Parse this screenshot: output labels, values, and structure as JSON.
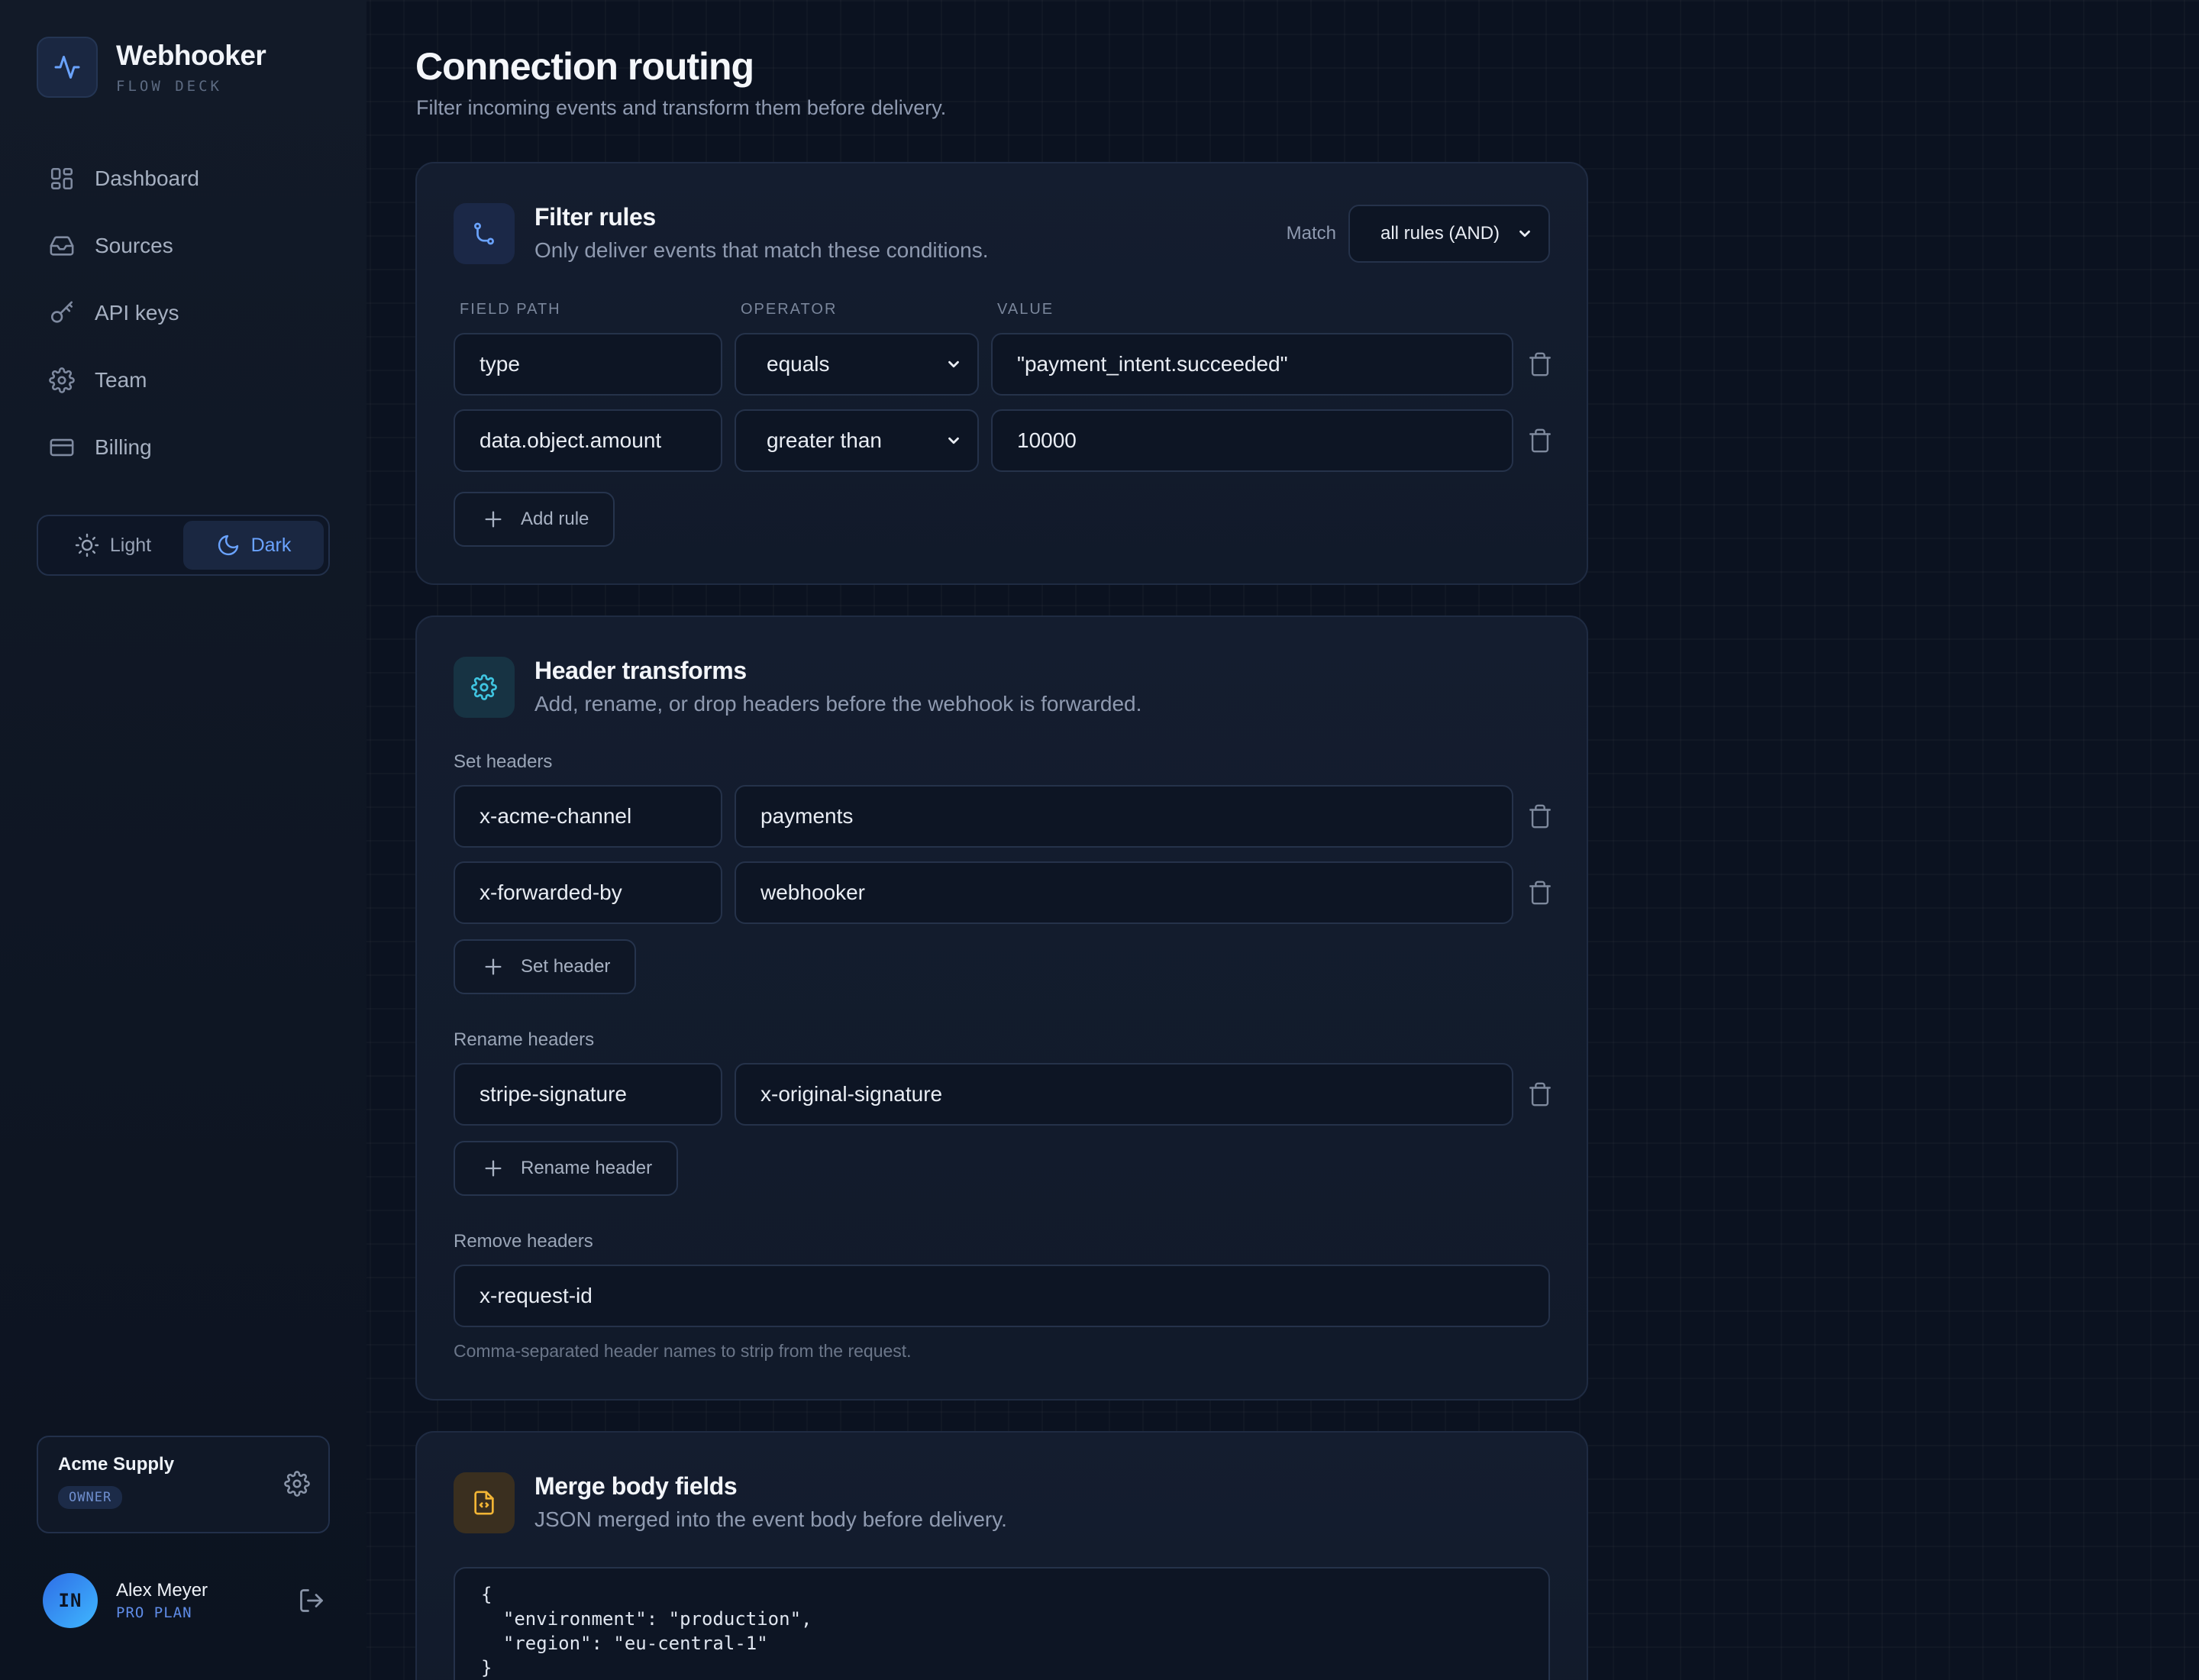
{
  "app": {
    "name": "Webhooker",
    "tagline": "FLOW DECK",
    "accent": "#6aa3ff"
  },
  "sidebar": {
    "items": [
      {
        "label": "Dashboard",
        "icon": "grid-icon"
      },
      {
        "label": "Sources",
        "icon": "inbox-icon"
      },
      {
        "label": "API keys",
        "icon": "key-icon"
      },
      {
        "label": "Team",
        "icon": "gear-icon"
      },
      {
        "label": "Billing",
        "icon": "credit-card-icon"
      }
    ],
    "theme": {
      "light_label": "Light",
      "dark_label": "Dark",
      "selected": "Dark"
    },
    "org": {
      "name": "Acme Supply",
      "role": "OWNER"
    },
    "user": {
      "initials": "IN",
      "name": "Alex Meyer",
      "plan": "PRO PLAN"
    }
  },
  "page": {
    "title": "Connection routing",
    "subtitle": "Filter incoming events and transform them before delivery."
  },
  "filter": {
    "title": "Filter rules",
    "description": "Only deliver events that match these conditions.",
    "match_label": "Match",
    "match_value": "all rules (AND)",
    "columns": {
      "field": "FIELD PATH",
      "operator": "OPERATOR",
      "value": "VALUE"
    },
    "rules": [
      {
        "field": "type",
        "operator": "equals",
        "value": "\"payment_intent.succeeded\""
      },
      {
        "field": "data.object.amount",
        "operator": "greater than",
        "value": "10000"
      }
    ],
    "add_label": "Add rule"
  },
  "headers": {
    "title": "Header transforms",
    "description": "Add, rename, or drop headers before the webhook is forwarded.",
    "set_label": "Set headers",
    "set": [
      {
        "name": "x-acme-channel",
        "value": "payments"
      },
      {
        "name": "x-forwarded-by",
        "value": "webhooker"
      }
    ],
    "set_button": "Set header",
    "rename_label": "Rename headers",
    "rename": [
      {
        "from": "stripe-signature",
        "to": "x-original-signature"
      }
    ],
    "rename_button": "Rename header",
    "remove_label": "Remove headers",
    "remove_value": "x-request-id",
    "remove_hint": "Comma-separated header names to strip from the request."
  },
  "merge": {
    "title": "Merge body fields",
    "description": "JSON merged into the event body before delivery.",
    "json": "{\n  \"environment\": \"production\",\n  \"region\": \"eu-central-1\"\n}"
  }
}
